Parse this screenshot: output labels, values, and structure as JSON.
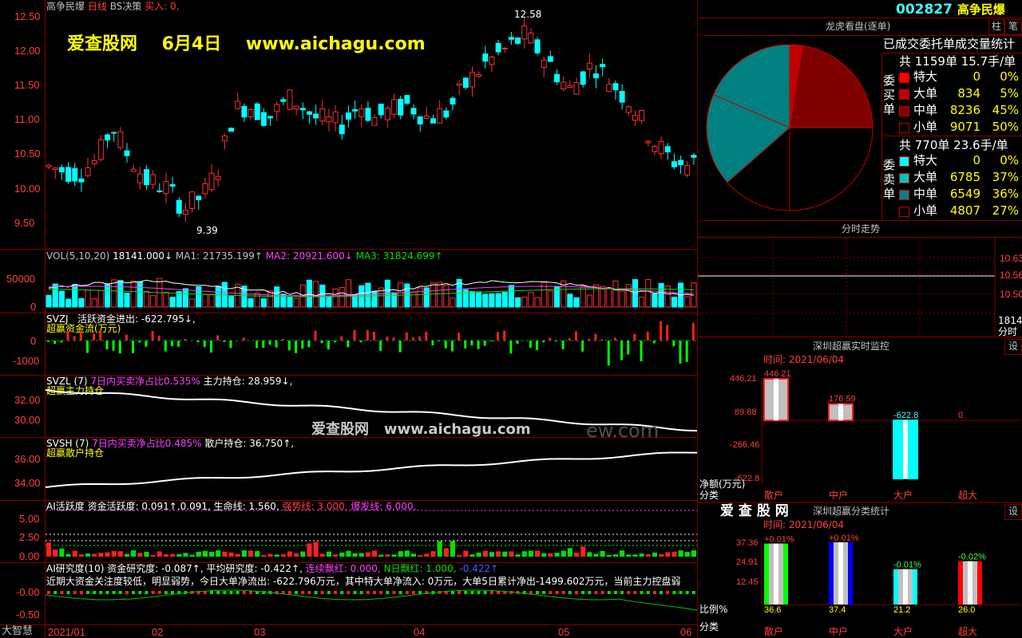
{
  "stock": {
    "code": "002827",
    "name": "高争民爆"
  },
  "main": {
    "header": {
      "name": "高争民爆",
      "period": "日线",
      "indicator": "BS决策",
      "signal": "买入: 0,"
    },
    "yticks": [
      "12.50",
      "12.00",
      "11.50",
      "11.00",
      "10.50",
      "10.00",
      "9.50"
    ],
    "high_label": "12.58",
    "low_label": "9.39",
    "watermark_site": "爱查股网",
    "watermark_date": "6月4日",
    "watermark_url": "www.aichagu.com"
  },
  "vol": {
    "label": "VOL(5,10,20)",
    "v": "18141.000↓",
    "ma1": "MA1: 21735.199↑",
    "ma2": "MA2: 20921.600↓",
    "ma3": "MA3: 31824.699↑",
    "yticks": [
      "50000",
      "0"
    ]
  },
  "svzj": {
    "label": "SVZJ",
    "text": "活跃资金进出: -622.795↓,",
    "sub": "超赢资金流(万元)",
    "yticks": [
      "0",
      "-1000"
    ]
  },
  "svzl": {
    "label": "SVZL (7)",
    "text1": "7日内买卖净占比0.535%",
    "text2": "主力持仓: 28.959↓,",
    "sub": "超赢主力持仓",
    "yticks": [
      "32.00",
      "30.00"
    ]
  },
  "svsh": {
    "label": "SVSH (7)",
    "text1": "7日内买卖净占比0.485%",
    "text2": "散户持仓: 36.750↑,",
    "sub": "超赢散户持仓",
    "yticks": [
      "36.00",
      "34.00"
    ],
    "wm_site": "爱查股网",
    "wm_url": "www.aichagu.com",
    "wm_tail": "ew.com"
  },
  "ai": {
    "label": "AI活跃度",
    "t1": "资金活跃度: 0.091↑,0.091,",
    "t2": "生命线: 1.560,",
    "t3": "强势线: 3.000,",
    "t4": "爆发线: 6.000,",
    "yticks": [
      "5.00",
      "2.50",
      "0.00"
    ]
  },
  "research": {
    "label": "AI研究度(10)",
    "t1": "资金研究度: -0.087↑,",
    "t2": "平均研究度: -0.422↑,",
    "t3": "连续飘红: 0.000,",
    "t4": "N日飘红: 1.000,",
    "t5": "-0.422↑",
    "comment": "近期大资金关注度较低，明显弱势，今日大单净流出: -622.796万元，其中特大单净流入: 0万元，大单5日累计净出-1499.602万元，当前主力控盘弱",
    "yticks": [
      "-0.00",
      "-0.50"
    ]
  },
  "xaxis": {
    "labels": [
      "2021/01",
      "02",
      "03",
      "04",
      "05",
      "06"
    ],
    "corner": "大智慧"
  },
  "right": {
    "btn_zhu": "柱",
    "btn_bi": "笔",
    "title": "龙虎看盘(逐单)",
    "subtitle": "已成交委托单成交量统计",
    "buy": {
      "side": "委买单",
      "total": "共 1159单 15.7手/单",
      "rows": [
        {
          "name": "特大",
          "count": "0",
          "pct": "0%",
          "color": "#ff0000"
        },
        {
          "name": "大单",
          "count": "834",
          "pct": "5%",
          "color": "#c00000"
        },
        {
          "name": "中单",
          "count": "8236",
          "pct": "45%",
          "color": "#800000"
        },
        {
          "name": "小单",
          "count": "9071",
          "pct": "50%",
          "color": "#000000"
        }
      ]
    },
    "sell": {
      "side": "委卖单",
      "total": "共 770单 23.6手/单",
      "rows": [
        {
          "name": "特大",
          "count": "0",
          "pct": "0%",
          "color": "#00ffff"
        },
        {
          "name": "大单",
          "count": "6785",
          "pct": "37%",
          "color": "#00c0c0"
        },
        {
          "name": "中单",
          "count": "6549",
          "pct": "36%",
          "color": "#008080"
        },
        {
          "name": "小单",
          "count": "4807",
          "pct": "27%",
          "color": "#000000"
        }
      ]
    },
    "pie": [
      {
        "label": "买小单",
        "value": 50,
        "color": "#000"
      },
      {
        "label": "买中单",
        "value": 45,
        "color": "#800000"
      },
      {
        "label": "买大单",
        "value": 5,
        "color": "#c00000"
      },
      {
        "label": "卖小单",
        "value": 27,
        "color": "#000"
      },
      {
        "label": "卖中单",
        "value": 36,
        "color": "#008080"
      },
      {
        "label": "卖大单",
        "value": 37,
        "color": "#008080"
      }
    ],
    "fenshi": {
      "title": "分时走势",
      "ticks": [
        "10.63",
        "10.56",
        "10.50"
      ],
      "footer": "18141",
      "footer2": "分时"
    },
    "monitor": {
      "title": "深圳超赢实时监控",
      "btn": "设",
      "time": "时间: 2021/06/04",
      "yticks": [
        "446.21",
        "89.88",
        "-266.46",
        "-622.8"
      ],
      "unit": "净额(万元)",
      "cat_label": "分类",
      "bars": [
        {
          "cat": "散户",
          "value": 446.21,
          "label": "446.21"
        },
        {
          "cat": "中户",
          "value": 176.59,
          "label": "176.59"
        },
        {
          "cat": "大户",
          "value": -622.8,
          "label": "-622.8"
        },
        {
          "cat": "超大",
          "value": 0,
          "label": "0"
        }
      ]
    },
    "stats": {
      "logo": "爱 查 股 网",
      "title": "深圳超赢分类统计",
      "btn": "设",
      "time": "时间: 2021/06/04",
      "yticks": [
        "37.36",
        "24.91",
        "12.45"
      ],
      "ratio_label": "比例%",
      "cat_label": "分类",
      "bars": [
        {
          "cat": "散户",
          "value": 36.6,
          "label": "36.6",
          "change": "+0.01%",
          "color": "#00ff00"
        },
        {
          "cat": "中户",
          "value": 37.4,
          "label": "37.4",
          "change": "+0.01%",
          "color": "#0000ff"
        },
        {
          "cat": "大户",
          "value": 21.2,
          "label": "21.2",
          "change": "-0.01%",
          "color": "#00ffff"
        },
        {
          "cat": "超大",
          "value": 26.0,
          "label": "26.0",
          "change": "-0.02%",
          "color": "#ff0000"
        }
      ]
    }
  }
}
